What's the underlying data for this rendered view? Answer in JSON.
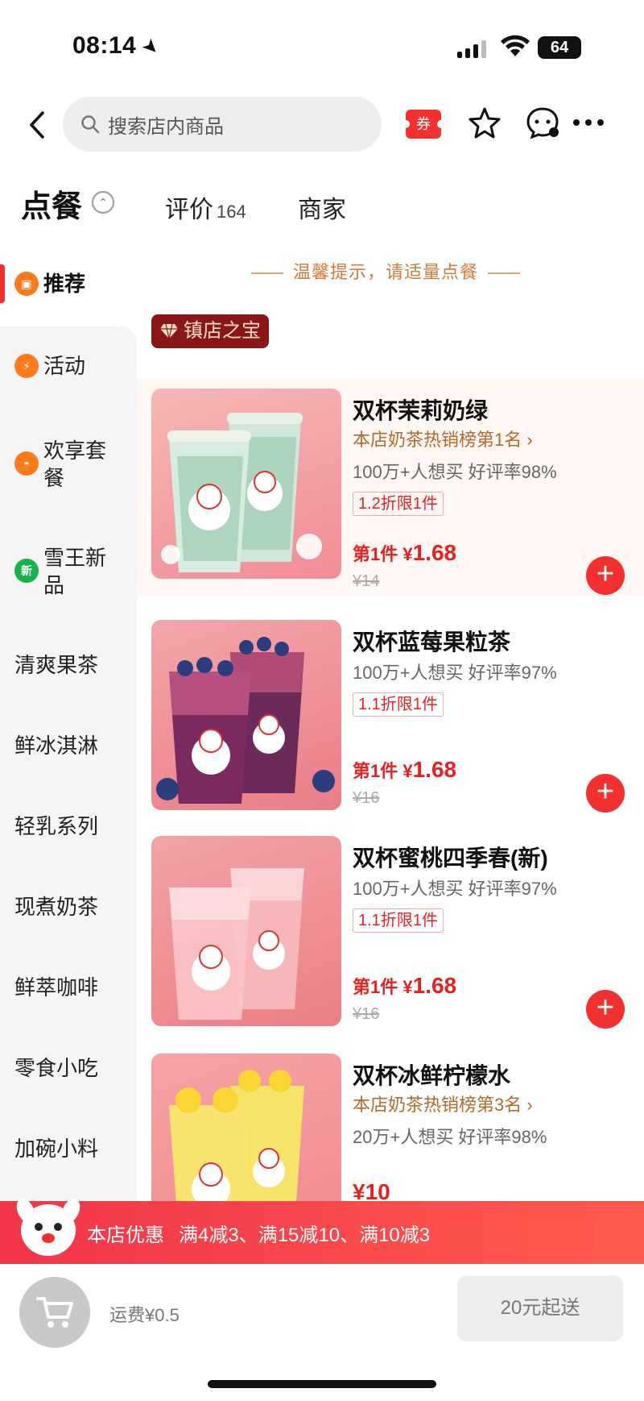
{
  "status": {
    "time": "08:14",
    "battery": "64"
  },
  "header": {
    "search_placeholder": "搜索店内商品",
    "coupon_label": "券"
  },
  "tabs": {
    "order": "点餐",
    "reviews": "评价",
    "reviews_count": "164",
    "merchant": "商家"
  },
  "sidebar": {
    "items": [
      {
        "label": "推荐",
        "icon": "recommend-icon",
        "active": true
      },
      {
        "label": "活动",
        "icon": "lightning-icon"
      },
      {
        "label": "欢享套餐",
        "icon": "combo-icon"
      },
      {
        "label": "雪王新品",
        "icon": "new-icon",
        "icon_text": "新"
      },
      {
        "label": "清爽果茶"
      },
      {
        "label": "鲜冰淇淋"
      },
      {
        "label": "轻乳系列"
      },
      {
        "label": "现煮奶茶"
      },
      {
        "label": "鲜萃咖啡"
      },
      {
        "label": "零食小吃"
      },
      {
        "label": "加碗小料"
      }
    ]
  },
  "main": {
    "tip": "温馨提示，请适量点餐",
    "section_badge": "镇店之宝",
    "products": [
      {
        "name": "双杯茉莉奶绿",
        "rank": "本店奶茶热销榜第1名 ›",
        "stats": "100万+人想买  好评率98%",
        "discount": "1.2折限1件",
        "price_prefix": "第1件 ¥",
        "price": "1.68",
        "original": "¥14"
      },
      {
        "name": "双杯蓝莓果粒茶",
        "stats": "100万+人想买  好评率97%",
        "discount": "1.1折限1件",
        "price_prefix": "第1件 ¥",
        "price": "1.68",
        "original": "¥16"
      },
      {
        "name": "双杯蜜桃四季春(新)",
        "stats": "100万+人想买  好评率97%",
        "discount": "1.1折限1件",
        "price_prefix": "第1件 ¥",
        "price": "1.68",
        "original": "¥16"
      },
      {
        "name": "双杯冰鲜柠檬水",
        "rank": "本店奶茶热销榜第3名 ›",
        "stats": "20万+人想买  好评率98%",
        "price": "¥10"
      }
    ]
  },
  "promo": {
    "label": "本店优惠",
    "text": "满4减3、满15减10、满10减3"
  },
  "cart": {
    "shipping": "运费¥0.5",
    "min_order": "20元起送"
  },
  "colors": {
    "accent_red": "#f23030",
    "rank_brown": "#b06a2a",
    "tip_orange": "#d27a3a"
  }
}
